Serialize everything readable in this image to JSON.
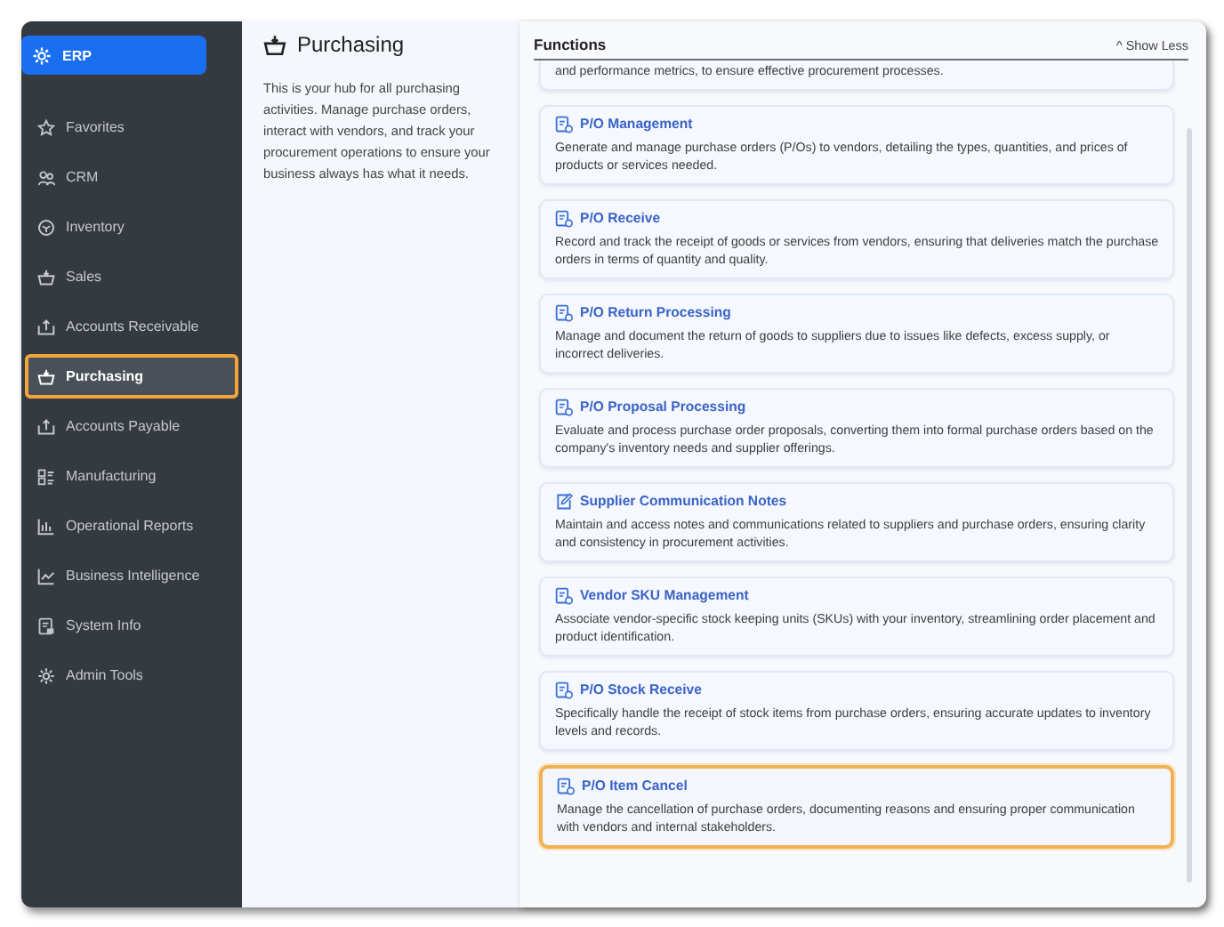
{
  "app": {
    "name": "ERP"
  },
  "sidebar": {
    "items": [
      {
        "label": "Favorites",
        "selected": false
      },
      {
        "label": "CRM",
        "selected": false
      },
      {
        "label": "Inventory",
        "selected": false
      },
      {
        "label": "Sales",
        "selected": false
      },
      {
        "label": "Accounts Receivable",
        "selected": false
      },
      {
        "label": "Purchasing",
        "selected": true
      },
      {
        "label": "Accounts Payable",
        "selected": false
      },
      {
        "label": "Manufacturing",
        "selected": false
      },
      {
        "label": "Operational Reports",
        "selected": false
      },
      {
        "label": "Business Intelligence",
        "selected": false
      },
      {
        "label": "System Info",
        "selected": false
      },
      {
        "label": "Admin Tools",
        "selected": false
      }
    ]
  },
  "intro": {
    "title": "Purchasing",
    "text": "This is your hub for all purchasing activities. Manage purchase orders, interact with vendors, and track your procurement operations to ensure your business always has what it needs."
  },
  "functions": {
    "title": "Functions",
    "toggle": "^ Show Less",
    "cards": [
      {
        "kind": "partial",
        "description": "and performance metrics, to ensure effective procurement processes.",
        "highlighted": false
      },
      {
        "kind": "full",
        "title": "P/O Management",
        "description": "Generate and manage purchase orders (P/Os) to vendors, detailing the types, quantities, and prices of products or services needed.",
        "highlighted": false
      },
      {
        "kind": "full",
        "title": "P/O Receive",
        "description": "Record and track the receipt of goods or services from vendors, ensuring that deliveries match the purchase orders in terms of quantity and quality.",
        "highlighted": false
      },
      {
        "kind": "full",
        "title": "P/O Return Processing",
        "description": "Manage and document the return of goods to suppliers due to issues like defects, excess supply, or incorrect deliveries.",
        "highlighted": false
      },
      {
        "kind": "full",
        "title": "P/O Proposal Processing",
        "description": "Evaluate and process purchase order proposals, converting them into formal purchase orders based on the company's inventory needs and supplier offerings.",
        "highlighted": false
      },
      {
        "kind": "full",
        "title": "Supplier Communication Notes",
        "description": "Maintain and access notes and communications related to suppliers and purchase orders, ensuring clarity and consistency in procurement activities.",
        "highlighted": false
      },
      {
        "kind": "full",
        "title": "Vendor SKU Management",
        "description": "Associate vendor-specific stock keeping units (SKUs) with your inventory, streamlining order placement and product identification.",
        "highlighted": false
      },
      {
        "kind": "full",
        "title": "P/O Stock Receive",
        "description": "Specifically handle the receipt of stock items from purchase orders, ensuring accurate updates to inventory levels and records.",
        "highlighted": false
      },
      {
        "kind": "full",
        "title": "P/O Item Cancel",
        "description": "Manage the cancellation of purchase orders, documenting reasons and ensuring proper communication with vendors and internal stakeholders.",
        "highlighted": true
      }
    ]
  }
}
